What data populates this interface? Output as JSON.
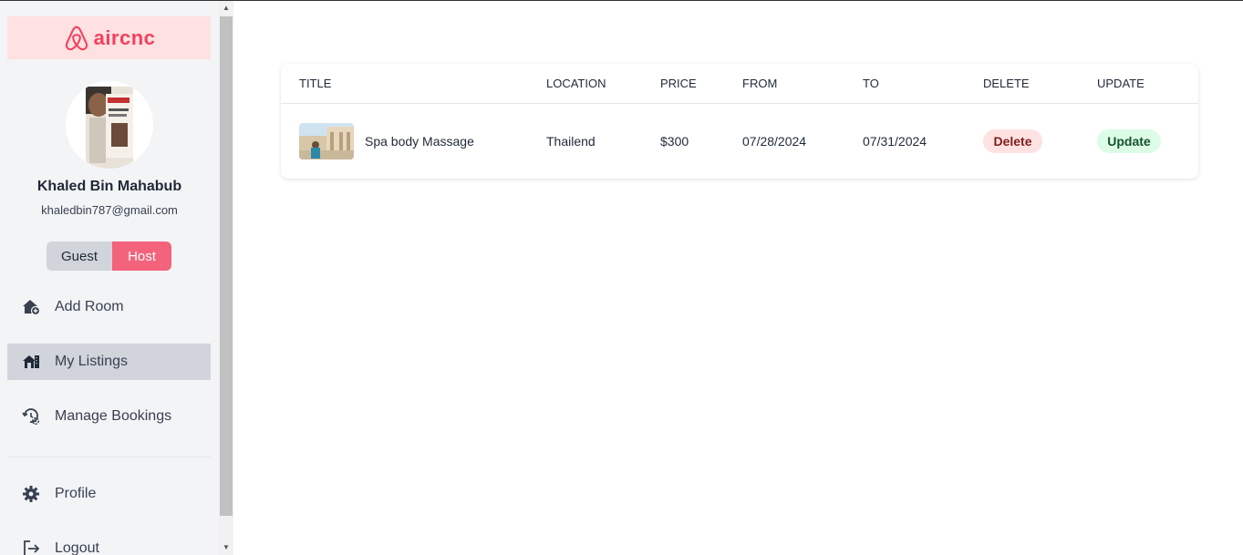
{
  "brand": {
    "name": "aircnc",
    "color": "#f43f5e"
  },
  "user": {
    "name": "Khaled Bin Mahabub",
    "email": "khaledbin787@gmail.com"
  },
  "role_toggle": {
    "guest_label": "Guest",
    "host_label": "Host",
    "active": "Host"
  },
  "nav": {
    "items": [
      {
        "label": "Add Room",
        "icon": "house-plus-icon"
      },
      {
        "label": "My Listings",
        "icon": "house-listings-icon",
        "active": true
      },
      {
        "label": "Manage Bookings",
        "icon": "calendar-clock-icon"
      }
    ],
    "bottom": [
      {
        "label": "Profile",
        "icon": "gear-icon"
      },
      {
        "label": "Logout",
        "icon": "logout-icon"
      }
    ]
  },
  "table": {
    "headers": [
      "TITLE",
      "LOCATION",
      "PRICE",
      "FROM",
      "TO",
      "DELETE",
      "UPDATE"
    ],
    "rows": [
      {
        "title": "Spa body Massage",
        "location": "Thailend",
        "price": "$300",
        "from": "07/28/2024",
        "to": "07/31/2024",
        "delete_label": "Delete",
        "update_label": "Update"
      }
    ]
  }
}
